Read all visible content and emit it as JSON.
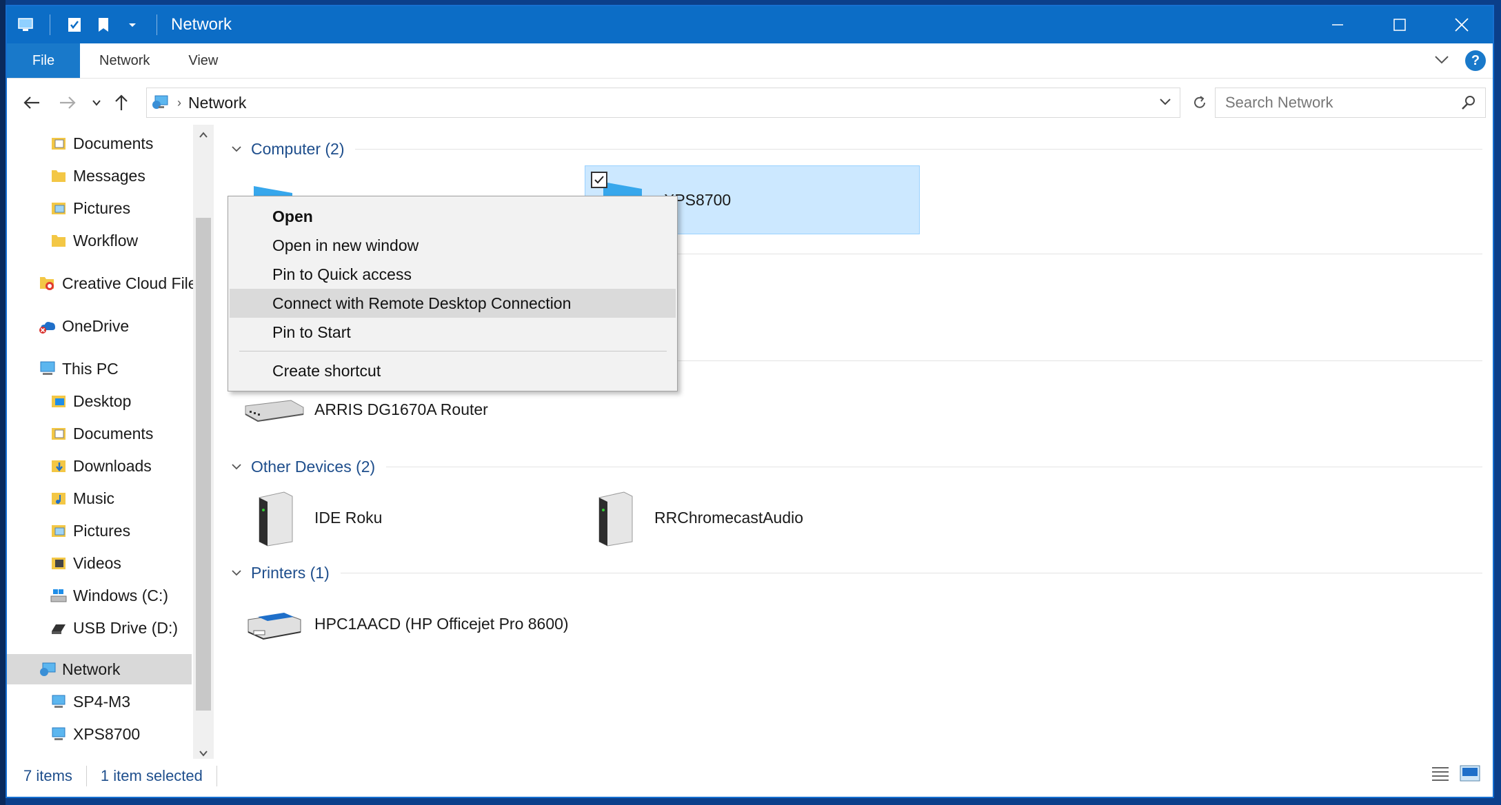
{
  "window": {
    "title": "Network",
    "controls": [
      "minimize",
      "maximize",
      "close"
    ]
  },
  "ribbon": {
    "tabs": [
      "File",
      "Network",
      "View"
    ]
  },
  "address": {
    "path": "Network",
    "search_placeholder": "Search Network"
  },
  "sidebar": {
    "items": [
      {
        "label": "Documents",
        "icon": "documents-folder-icon"
      },
      {
        "label": "Messages",
        "icon": "folder-icon"
      },
      {
        "label": "Pictures",
        "icon": "pictures-folder-icon"
      },
      {
        "label": "Workflow",
        "icon": "folder-icon"
      },
      {
        "label": "Creative Cloud Files",
        "icon": "creative-cloud-icon"
      },
      {
        "label": "OneDrive",
        "icon": "onedrive-icon"
      },
      {
        "label": "This PC",
        "icon": "this-pc-icon"
      },
      {
        "label": "Desktop",
        "icon": "desktop-folder-icon"
      },
      {
        "label": "Documents",
        "icon": "documents-folder-icon"
      },
      {
        "label": "Downloads",
        "icon": "downloads-folder-icon"
      },
      {
        "label": "Music",
        "icon": "music-folder-icon"
      },
      {
        "label": "Pictures",
        "icon": "pictures-folder-icon"
      },
      {
        "label": "Videos",
        "icon": "videos-folder-icon"
      },
      {
        "label": "Windows (C:)",
        "icon": "drive-icon"
      },
      {
        "label": "USB Drive (D:)",
        "icon": "usb-drive-icon"
      },
      {
        "label": "Network",
        "icon": "network-icon"
      },
      {
        "label": "SP4-M3",
        "icon": "computer-icon"
      },
      {
        "label": "XPS8700",
        "icon": "computer-icon"
      }
    ]
  },
  "content": {
    "groups": [
      {
        "label": "Computer (2)"
      },
      {
        "label": "Other Devices (2)"
      },
      {
        "label": "Printers (1)"
      }
    ],
    "computers": [
      "",
      "XPS8700"
    ],
    "router": "ARRIS DG1670A Router",
    "other_devices": [
      "IDE Roku",
      "RRChromecastAudio"
    ],
    "printers": [
      "HPC1AACD (HP Officejet Pro 8600)"
    ]
  },
  "context_menu": {
    "items": [
      "Open",
      "Open in new window",
      "Pin to Quick access",
      "Connect with Remote Desktop Connection",
      "Pin to Start",
      "Create shortcut"
    ]
  },
  "status": {
    "count": "7 items",
    "selection": "1 item selected"
  },
  "colors": {
    "titlebar": "#0c6dc6",
    "file_tab": "#1979ca",
    "group_header": "#1e4e8c",
    "selection": "#cce8ff"
  }
}
